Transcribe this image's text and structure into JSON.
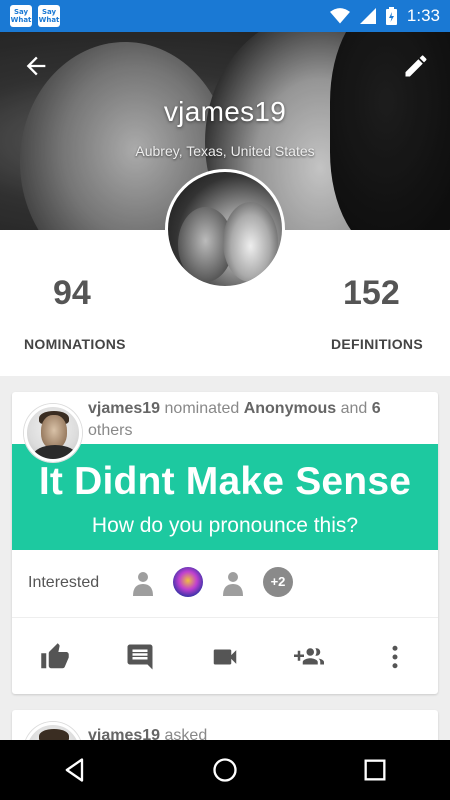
{
  "status_bar": {
    "app_icons": [
      "Say What",
      "Say What"
    ],
    "time": "1:33",
    "color": "#1a79d4"
  },
  "profile": {
    "username": "vjames19",
    "location": "Aubrey, Texas, United States",
    "stats": {
      "nominations_count": "94",
      "nominations_label": "NOMINATIONS",
      "definitions_count": "152",
      "definitions_label": "DEFINITIONS"
    }
  },
  "feed": {
    "cards": [
      {
        "actor": "vjames19",
        "verb": "nominated",
        "target": "Anonymous",
        "connector": "and",
        "others_count": "6",
        "others_label": "others",
        "title": "It Didnt Make Sense",
        "subtitle": "How do you pronounce this?",
        "banner_color": "#1dc9a0",
        "interested_label": "Interested",
        "extra_interested": "+2",
        "actions": [
          "thumb-up-icon",
          "comment-icon",
          "video-icon",
          "add-group-icon",
          "more-vert-icon"
        ]
      },
      {
        "actor": "vjames19",
        "verb": "asked"
      }
    ]
  }
}
